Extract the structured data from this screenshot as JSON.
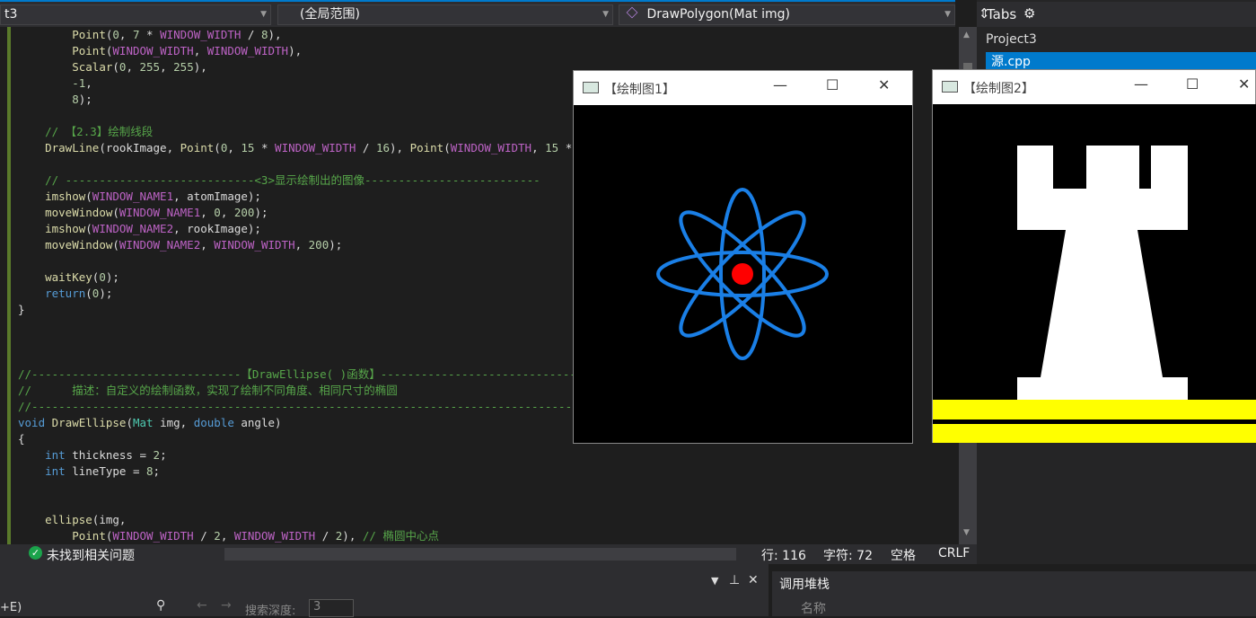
{
  "navbar": {
    "project_scope": "t3",
    "global_scope": "(全局范围)",
    "member": "DrawPolygon(Mat img)"
  },
  "solution_explorer": {
    "header": "Tabs",
    "project": "Project3",
    "file": "源.cpp"
  },
  "code_lines": [
    "        Point(0, 7 * WINDOW_WIDTH / 8),",
    "        Point(WINDOW_WIDTH, WINDOW_WIDTH),",
    "        Scalar(0, 255, 255),",
    "        -1,",
    "        8);",
    "",
    "    // 【2.3】绘制线段",
    "    DrawLine(rookImage, Point(0, 15 * WINDOW_WIDTH / 16), Point(WINDOW_WIDTH, 15 * W",
    "",
    "    // ----------------------------<3>显示绘制出的图像--------------------------",
    "    imshow(WINDOW_NAME1, atomImage);",
    "    moveWindow(WINDOW_NAME1, 0, 200);",
    "    imshow(WINDOW_NAME2, rookImage);",
    "    moveWindow(WINDOW_NAME2, WINDOW_WIDTH, 200);",
    "",
    "    waitKey(0);",
    "    return(0);",
    "}",
    "",
    "",
    "",
    "//-------------------------------【DrawEllipse( )函数】-------------------------------",
    "//      描述：自定义的绘制函数，实现了绘制不同角度、相同尺寸的椭圆",
    "//-----------------------------------------------------------------------------------------",
    "void DrawEllipse(Mat img, double angle)",
    "{",
    "    int thickness = 2;",
    "    int lineType = 8;",
    "",
    "",
    "    ellipse(img,",
    "        Point(WINDOW_WIDTH / 2, WINDOW_WIDTH / 2), // 椭圆中心点"
  ],
  "status": {
    "issues": "未找到相关问题",
    "line": "行: 116",
    "char": "字符: 72",
    "indent": "空格",
    "eol": "CRLF"
  },
  "bottom": {
    "left_label": "+E)",
    "search_depth_label": "搜索深度:",
    "search_depth_value": "3",
    "callstack_title": "调用堆栈",
    "callstack_col": "名称"
  },
  "windows": [
    {
      "title": "【绘制图1】"
    },
    {
      "title": "【绘制图2】"
    }
  ],
  "colors": {
    "accent": "#007acc",
    "atom_orbit": "#1a7fe6",
    "atom_core": "#ff0000",
    "rook": "#ffffff",
    "rook_base": "#ffff00"
  }
}
